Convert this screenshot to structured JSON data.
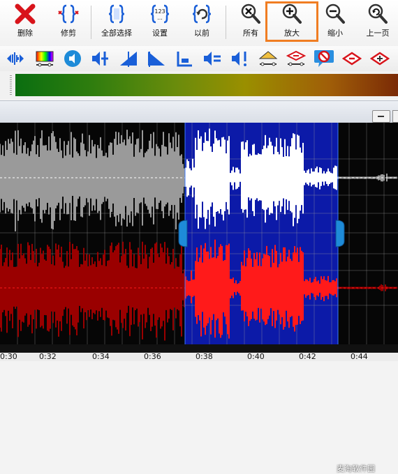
{
  "toolbar": {
    "delete_label": "删除",
    "trim_label": "修剪",
    "select_all_label": "全部选择",
    "settings_label": "设置",
    "previous_label": "以前",
    "all_label": "所有",
    "zoom_in_label": "放大",
    "zoom_out_label": "缩小",
    "prev_page_label": "上一页"
  },
  "colors": {
    "highlight": "#f07d22",
    "selection": "#0c1aa8",
    "left_channel": "#9a9a9a",
    "right_channel": "#c80000"
  },
  "timeline": {
    "ticks": [
      "0:30",
      "0:32",
      "0:34",
      "0:36",
      "0:38",
      "0:40",
      "0:42",
      "0:44"
    ]
  },
  "watermark": "麦淘软件园"
}
